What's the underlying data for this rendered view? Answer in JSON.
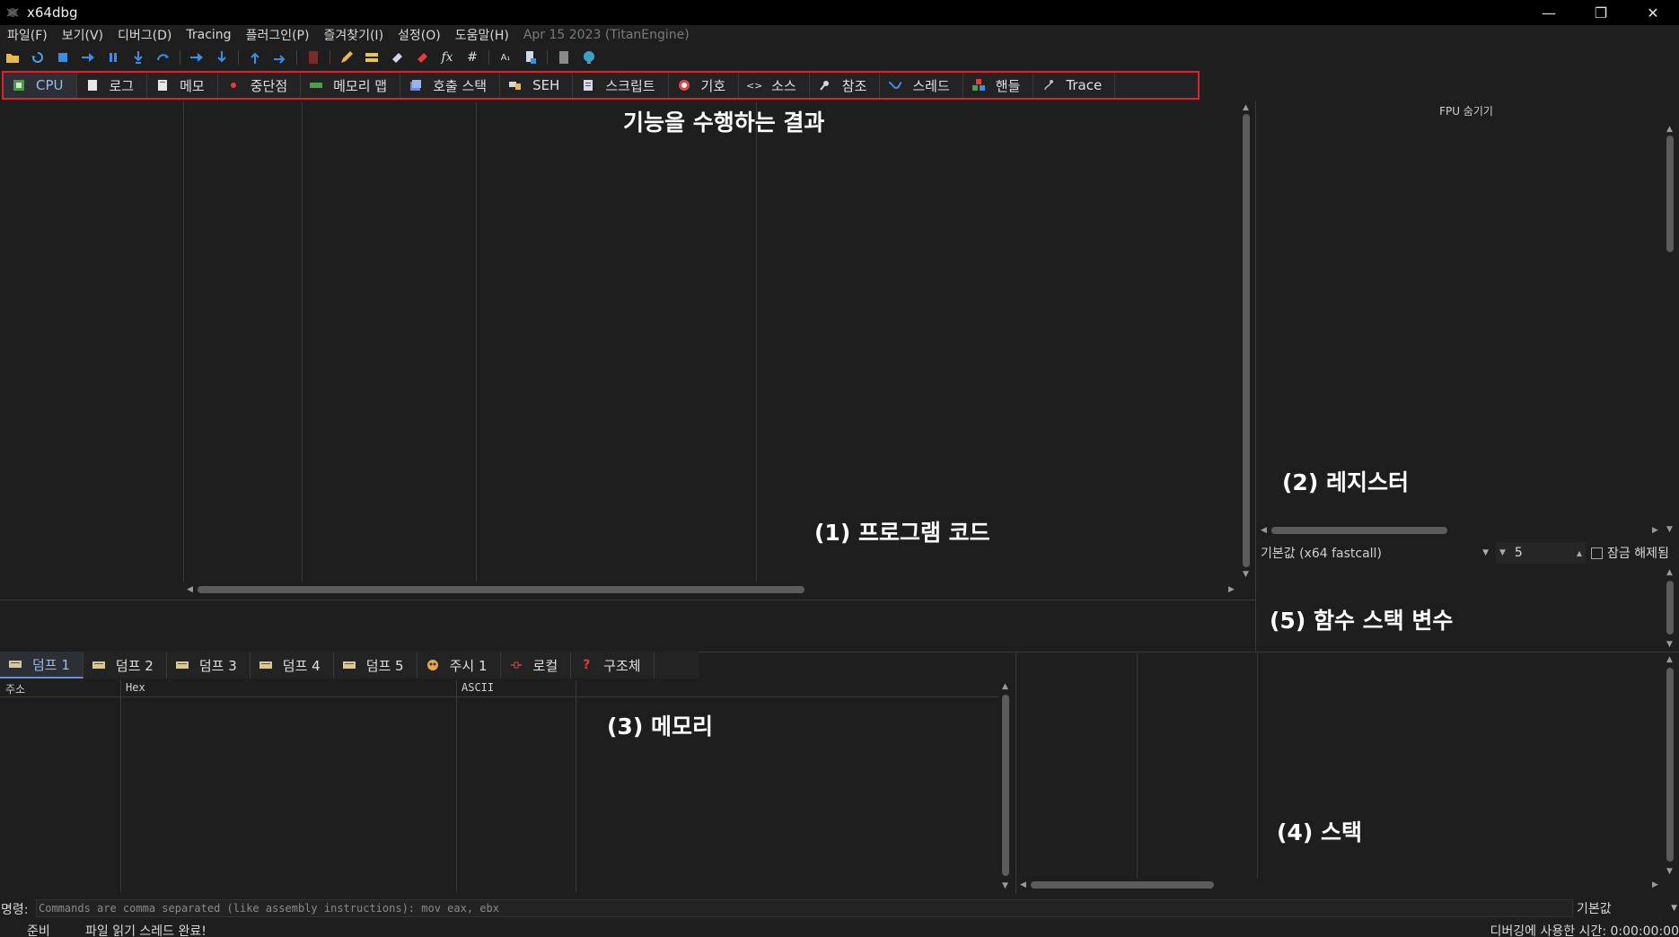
{
  "window": {
    "title": "x64dbg"
  },
  "menu": {
    "items": [
      "파일(F)",
      "보기(V)",
      "디버그(D)",
      "Tracing",
      "플러그인(P)",
      "즐겨찾기(I)",
      "설정(O)",
      "도움말(H)"
    ],
    "build": "Apr 15 2023 (TitanEngine)"
  },
  "main_tabs": [
    {
      "label": "CPU",
      "icon": "cpu-icon"
    },
    {
      "label": "로그",
      "icon": "log-icon"
    },
    {
      "label": "메모",
      "icon": "notes-icon"
    },
    {
      "label": "중단점",
      "icon": "breakpoint-icon"
    },
    {
      "label": "메모리 맵",
      "icon": "memory-map-icon"
    },
    {
      "label": "호출 스택",
      "icon": "call-stack-icon"
    },
    {
      "label": "SEH",
      "icon": "seh-icon"
    },
    {
      "label": "스크립트",
      "icon": "script-icon"
    },
    {
      "label": "기호",
      "icon": "symbols-icon"
    },
    {
      "label": "소스",
      "icon": "source-icon"
    },
    {
      "label": "참조",
      "icon": "references-icon"
    },
    {
      "label": "스레드",
      "icon": "threads-icon"
    },
    {
      "label": "핸들",
      "icon": "handles-icon"
    },
    {
      "label": "Trace",
      "icon": "trace-icon"
    }
  ],
  "annotations": {
    "result": "기능을 수행하는 결과",
    "program_code": "(1) 프로그램 코드",
    "registers": "(2) 레지스터",
    "memory": "(3) 메모리",
    "stack": "(4) 스택",
    "func_stack_vars": "(5) 함수 스택 변수"
  },
  "registers": {
    "fpu_toggle": "FPU 숨기기"
  },
  "callconv": {
    "selected": "기본값 (x64 fastcall)",
    "count": "5",
    "unlock_label": "잠금 해제됨"
  },
  "dump_tabs": [
    {
      "label": "덤프 1",
      "icon": "dump-icon"
    },
    {
      "label": "덤프 2",
      "icon": "dump-icon"
    },
    {
      "label": "덤프 3",
      "icon": "dump-icon"
    },
    {
      "label": "덤프 4",
      "icon": "dump-icon"
    },
    {
      "label": "덤프 5",
      "icon": "dump-icon"
    },
    {
      "label": "주시 1",
      "icon": "watch-icon"
    },
    {
      "label": "로컬",
      "icon": "locals-icon"
    },
    {
      "label": "구조체",
      "icon": "struct-icon"
    }
  ],
  "dump_columns": [
    "주소",
    "Hex",
    "ASCII"
  ],
  "command": {
    "label": "명령:",
    "placeholder": "Commands are comma separated (like assembly instructions): mov eax, ebx",
    "mode": "기본값"
  },
  "status": {
    "state": "준비",
    "message": "파일 읽기 스레드 완료!",
    "time_label": "디버깅에 사용한 시간: 0:00:00:00"
  },
  "colors": {
    "accent_red": "#e0202a",
    "active_tab": "#9ab8e8"
  }
}
